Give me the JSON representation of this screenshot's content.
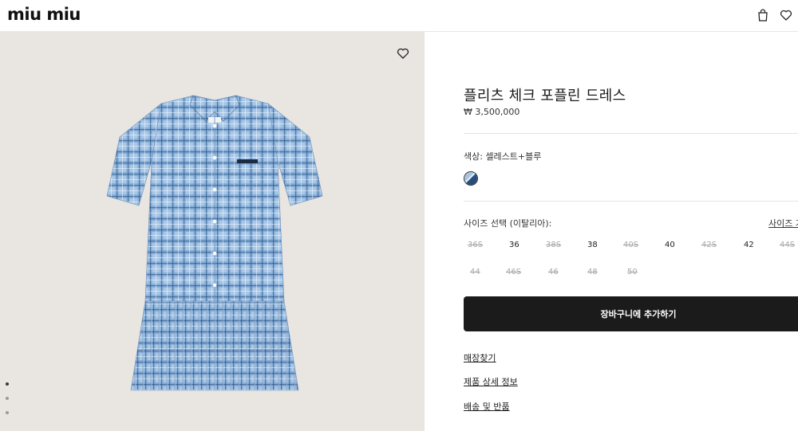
{
  "header": {
    "logo": "miu miu",
    "icons": [
      "bag-icon",
      "heart-icon"
    ]
  },
  "gallery": {
    "wishlist_icon": "heart-icon",
    "image_description_icon": "dress-image",
    "slides": 3,
    "active_slide": 1
  },
  "product": {
    "title": "플리츠 체크 포플린 드레스",
    "price": "₩ 3,500,000",
    "color_label": "색상:  셀레스트+블루",
    "size_label": "사이즈 선택 (이탈리아):",
    "size_guide": "사이즈 가",
    "sizes_row1": [
      {
        "label": "36S",
        "available": false
      },
      {
        "label": "36",
        "available": true
      },
      {
        "label": "38S",
        "available": false
      },
      {
        "label": "38",
        "available": true
      },
      {
        "label": "40S",
        "available": false
      },
      {
        "label": "40",
        "available": true
      },
      {
        "label": "42S",
        "available": false
      },
      {
        "label": "42",
        "available": true
      },
      {
        "label": "44S",
        "available": false
      }
    ],
    "sizes_row2": [
      {
        "label": "44",
        "available": false
      },
      {
        "label": "46S",
        "available": false
      },
      {
        "label": "46",
        "available": false
      },
      {
        "label": "48",
        "available": false
      },
      {
        "label": "50",
        "available": false
      }
    ],
    "add_to_cart": "장바구니에 추가하기",
    "links": [
      "매장찾기",
      "제품 상세 정보",
      "배송 및 반품"
    ]
  },
  "colors": {
    "button_bg": "#1b1b1b",
    "media_bg": "#e9e5e0",
    "swatch_light": "#a9c4e0",
    "swatch_dark": "#274d7a"
  }
}
